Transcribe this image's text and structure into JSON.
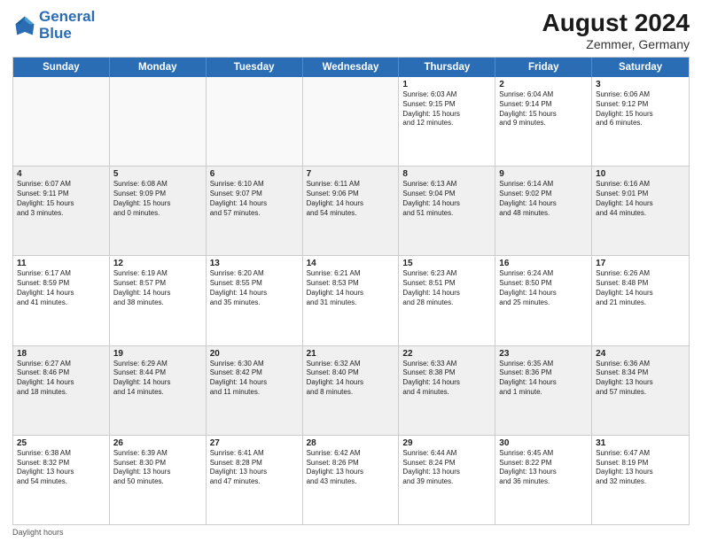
{
  "header": {
    "logo_line1": "General",
    "logo_line2": "Blue",
    "month_year": "August 2024",
    "location": "Zemmer, Germany"
  },
  "days": [
    "Sunday",
    "Monday",
    "Tuesday",
    "Wednesday",
    "Thursday",
    "Friday",
    "Saturday"
  ],
  "weeks": [
    [
      {
        "day": "",
        "text": ""
      },
      {
        "day": "",
        "text": ""
      },
      {
        "day": "",
        "text": ""
      },
      {
        "day": "",
        "text": ""
      },
      {
        "day": "1",
        "text": "Sunrise: 6:03 AM\nSunset: 9:15 PM\nDaylight: 15 hours\nand 12 minutes."
      },
      {
        "day": "2",
        "text": "Sunrise: 6:04 AM\nSunset: 9:14 PM\nDaylight: 15 hours\nand 9 minutes."
      },
      {
        "day": "3",
        "text": "Sunrise: 6:06 AM\nSunset: 9:12 PM\nDaylight: 15 hours\nand 6 minutes."
      }
    ],
    [
      {
        "day": "4",
        "text": "Sunrise: 6:07 AM\nSunset: 9:11 PM\nDaylight: 15 hours\nand 3 minutes."
      },
      {
        "day": "5",
        "text": "Sunrise: 6:08 AM\nSunset: 9:09 PM\nDaylight: 15 hours\nand 0 minutes."
      },
      {
        "day": "6",
        "text": "Sunrise: 6:10 AM\nSunset: 9:07 PM\nDaylight: 14 hours\nand 57 minutes."
      },
      {
        "day": "7",
        "text": "Sunrise: 6:11 AM\nSunset: 9:06 PM\nDaylight: 14 hours\nand 54 minutes."
      },
      {
        "day": "8",
        "text": "Sunrise: 6:13 AM\nSunset: 9:04 PM\nDaylight: 14 hours\nand 51 minutes."
      },
      {
        "day": "9",
        "text": "Sunrise: 6:14 AM\nSunset: 9:02 PM\nDaylight: 14 hours\nand 48 minutes."
      },
      {
        "day": "10",
        "text": "Sunrise: 6:16 AM\nSunset: 9:01 PM\nDaylight: 14 hours\nand 44 minutes."
      }
    ],
    [
      {
        "day": "11",
        "text": "Sunrise: 6:17 AM\nSunset: 8:59 PM\nDaylight: 14 hours\nand 41 minutes."
      },
      {
        "day": "12",
        "text": "Sunrise: 6:19 AM\nSunset: 8:57 PM\nDaylight: 14 hours\nand 38 minutes."
      },
      {
        "day": "13",
        "text": "Sunrise: 6:20 AM\nSunset: 8:55 PM\nDaylight: 14 hours\nand 35 minutes."
      },
      {
        "day": "14",
        "text": "Sunrise: 6:21 AM\nSunset: 8:53 PM\nDaylight: 14 hours\nand 31 minutes."
      },
      {
        "day": "15",
        "text": "Sunrise: 6:23 AM\nSunset: 8:51 PM\nDaylight: 14 hours\nand 28 minutes."
      },
      {
        "day": "16",
        "text": "Sunrise: 6:24 AM\nSunset: 8:50 PM\nDaylight: 14 hours\nand 25 minutes."
      },
      {
        "day": "17",
        "text": "Sunrise: 6:26 AM\nSunset: 8:48 PM\nDaylight: 14 hours\nand 21 minutes."
      }
    ],
    [
      {
        "day": "18",
        "text": "Sunrise: 6:27 AM\nSunset: 8:46 PM\nDaylight: 14 hours\nand 18 minutes."
      },
      {
        "day": "19",
        "text": "Sunrise: 6:29 AM\nSunset: 8:44 PM\nDaylight: 14 hours\nand 14 minutes."
      },
      {
        "day": "20",
        "text": "Sunrise: 6:30 AM\nSunset: 8:42 PM\nDaylight: 14 hours\nand 11 minutes."
      },
      {
        "day": "21",
        "text": "Sunrise: 6:32 AM\nSunset: 8:40 PM\nDaylight: 14 hours\nand 8 minutes."
      },
      {
        "day": "22",
        "text": "Sunrise: 6:33 AM\nSunset: 8:38 PM\nDaylight: 14 hours\nand 4 minutes."
      },
      {
        "day": "23",
        "text": "Sunrise: 6:35 AM\nSunset: 8:36 PM\nDaylight: 14 hours\nand 1 minute."
      },
      {
        "day": "24",
        "text": "Sunrise: 6:36 AM\nSunset: 8:34 PM\nDaylight: 13 hours\nand 57 minutes."
      }
    ],
    [
      {
        "day": "25",
        "text": "Sunrise: 6:38 AM\nSunset: 8:32 PM\nDaylight: 13 hours\nand 54 minutes."
      },
      {
        "day": "26",
        "text": "Sunrise: 6:39 AM\nSunset: 8:30 PM\nDaylight: 13 hours\nand 50 minutes."
      },
      {
        "day": "27",
        "text": "Sunrise: 6:41 AM\nSunset: 8:28 PM\nDaylight: 13 hours\nand 47 minutes."
      },
      {
        "day": "28",
        "text": "Sunrise: 6:42 AM\nSunset: 8:26 PM\nDaylight: 13 hours\nand 43 minutes."
      },
      {
        "day": "29",
        "text": "Sunrise: 6:44 AM\nSunset: 8:24 PM\nDaylight: 13 hours\nand 39 minutes."
      },
      {
        "day": "30",
        "text": "Sunrise: 6:45 AM\nSunset: 8:22 PM\nDaylight: 13 hours\nand 36 minutes."
      },
      {
        "day": "31",
        "text": "Sunrise: 6:47 AM\nSunset: 8:19 PM\nDaylight: 13 hours\nand 32 minutes."
      }
    ]
  ],
  "footer": "Daylight hours"
}
